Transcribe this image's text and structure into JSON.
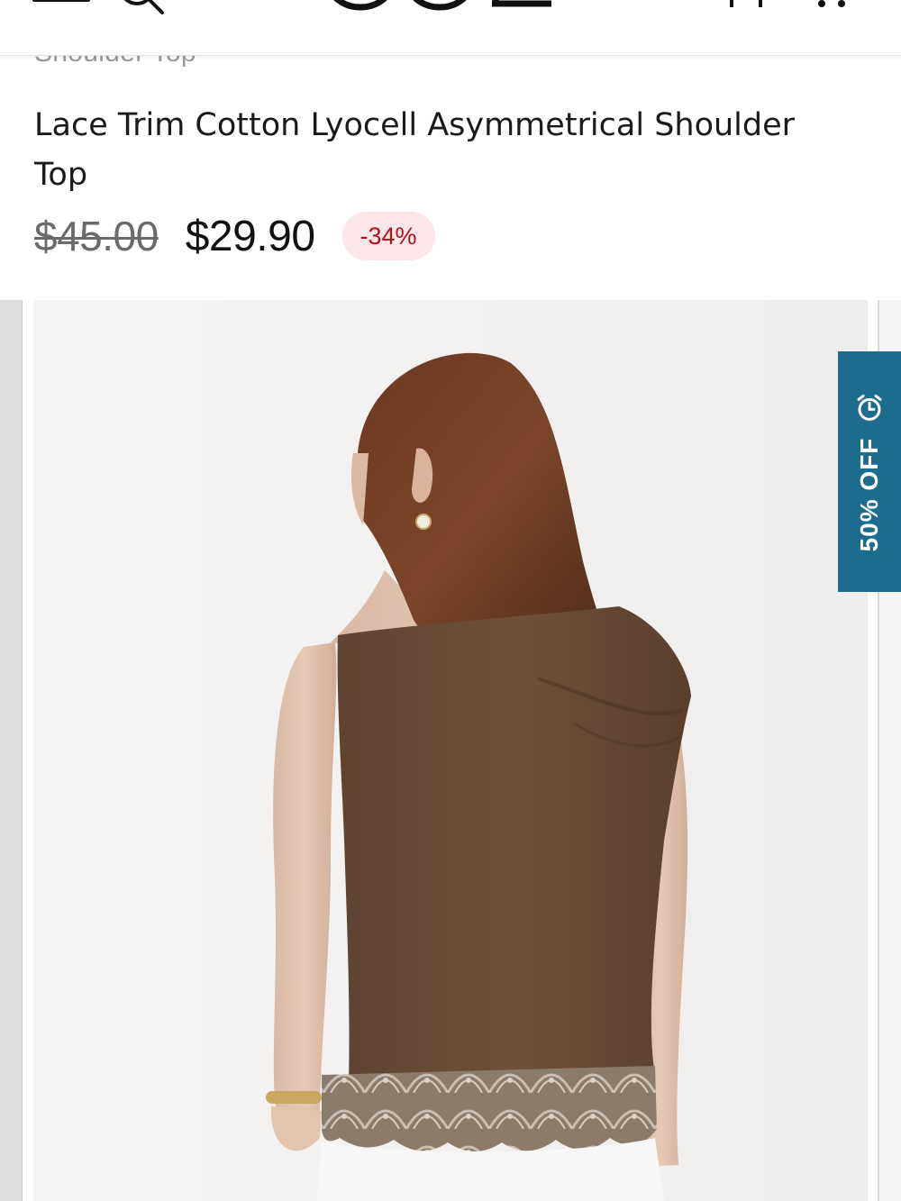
{
  "header": {
    "menu_icon": "hamburger-menu-icon",
    "search_icon": "search-icon",
    "logo_icon": "brand-logo",
    "bag_icon": "shopping-bag-icon",
    "more_icon": "more-options-icon"
  },
  "breadcrumb": "Shoulder Top",
  "product": {
    "title": "Lace Trim Cotton Lyocell Asymmetrical Shoulder Top",
    "original_price": "$45.00",
    "sale_price": "$29.90",
    "discount": "-34%"
  },
  "promo": {
    "label": "50% OFF",
    "icon": "alarm-clock-icon",
    "color": "#1d6b8d"
  },
  "colors": {
    "discount_text": "#b0121e",
    "discount_bg": "#fbe6e8",
    "garment": "#6e4e33"
  }
}
